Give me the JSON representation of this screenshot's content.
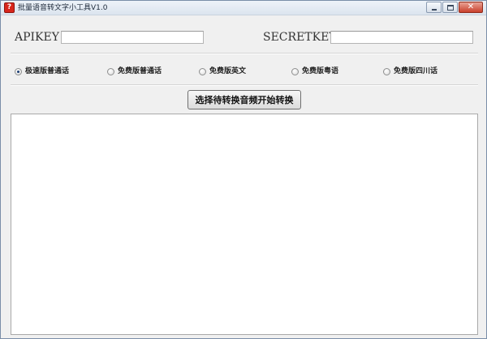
{
  "window": {
    "title": "批量语音转文字小工具V1.0",
    "app_icon_glyph": "?",
    "close_glyph": "✕"
  },
  "keys": {
    "api_label": "APIKEY",
    "api_value": "",
    "secret_label": "SECRETKEY",
    "secret_value": ""
  },
  "modes": [
    {
      "label": "极速版普通话",
      "checked": true
    },
    {
      "label": "免费版普通话",
      "checked": false
    },
    {
      "label": "免费版英文",
      "checked": false
    },
    {
      "label": "免费版粤语",
      "checked": false
    },
    {
      "label": "免费版四川话",
      "checked": false
    }
  ],
  "actions": {
    "convert_label": "选择待转换音频开始转换"
  },
  "output": {
    "text": ""
  },
  "colors": {
    "title_bar": "#dbe4ee",
    "window_bg": "#f0f0f0",
    "close_button": "#c9402c",
    "app_icon": "#d8261c"
  }
}
